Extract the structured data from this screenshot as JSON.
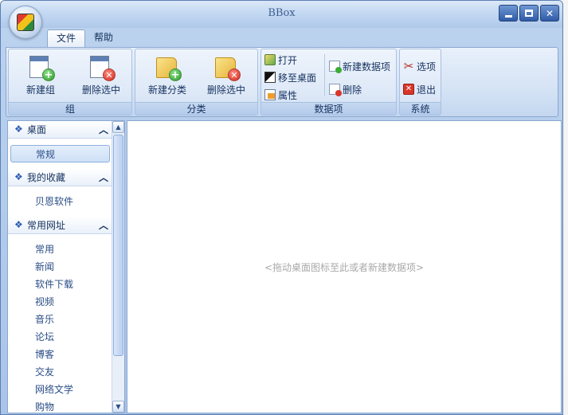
{
  "window": {
    "title": "BBox"
  },
  "menu_tabs": [
    {
      "label": "文件",
      "active": true
    },
    {
      "label": "帮助",
      "active": false
    }
  ],
  "ribbon": {
    "groups": [
      {
        "label": "组",
        "buttons": [
          {
            "label": "新建组",
            "icon": "new-window-icon"
          },
          {
            "label": "删除选中",
            "icon": "delete-window-icon"
          }
        ]
      },
      {
        "label": "分类",
        "buttons": [
          {
            "label": "新建分类",
            "icon": "new-folder-icon"
          },
          {
            "label": "删除选中",
            "icon": "delete-folder-icon"
          }
        ]
      },
      {
        "label": "数据项",
        "buttons": [
          {
            "label": "打开",
            "icon": "open-icon"
          },
          {
            "label": "移至桌面",
            "icon": "move-to-desktop-icon"
          },
          {
            "label": "属性",
            "icon": "properties-icon"
          },
          {
            "label": "新建数据项",
            "icon": "new-item-icon"
          },
          {
            "label": "删除",
            "icon": "delete-item-icon"
          }
        ]
      },
      {
        "label": "系统",
        "buttons": [
          {
            "label": "选项",
            "icon": "options-icon"
          },
          {
            "label": "退出",
            "icon": "exit-icon"
          }
        ]
      }
    ]
  },
  "sidebar": {
    "sections": [
      {
        "title": "桌面",
        "items": [
          "常规"
        ],
        "selected": "常规"
      },
      {
        "title": "我的收藏",
        "items": [
          "贝恩软件"
        ]
      },
      {
        "title": "常用网址",
        "items": [
          "常用",
          "新闻",
          "软件下载",
          "视频",
          "音乐",
          "论坛",
          "博客",
          "交友",
          "网络文学",
          "购物"
        ]
      }
    ]
  },
  "main": {
    "placeholder": "<拖动桌面图标至此或者新建数据项>"
  },
  "colors": {
    "accent": "#2a5ab3",
    "ribbon_bg": "#d5e3f5",
    "border": "#8ba7cf"
  }
}
